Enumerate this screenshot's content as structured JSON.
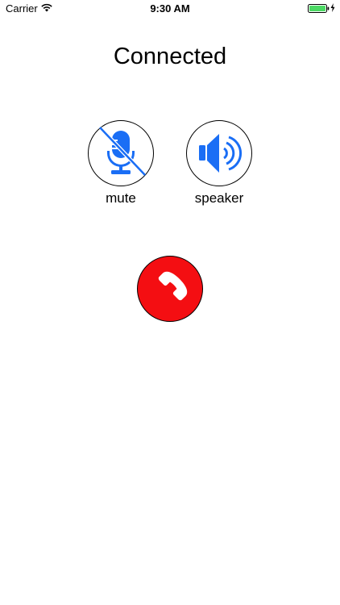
{
  "status_bar": {
    "carrier": "Carrier",
    "time": "9:30 AM",
    "icons": [
      "wifi-icon",
      "battery-icon",
      "charging-bolt-icon"
    ],
    "battery_color": "#4cd964"
  },
  "call": {
    "status_title": "Connected"
  },
  "controls": {
    "mute_label": "mute",
    "speaker_label": "speaker",
    "mute_icon": "microphone-muted-icon",
    "speaker_icon": "speaker-icon",
    "icon_color": "#1a6ef5"
  },
  "end_call": {
    "icon": "phone-hangup-icon",
    "color": "#f40e12"
  }
}
